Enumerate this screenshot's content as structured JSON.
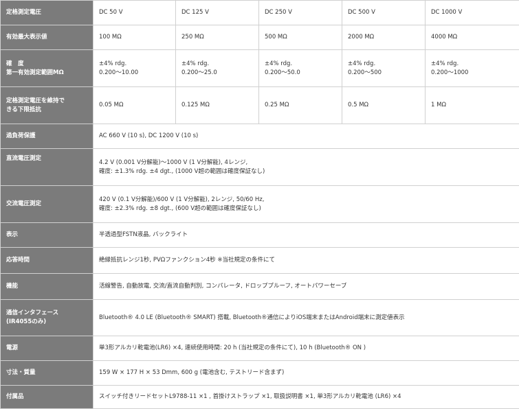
{
  "rows": [
    {
      "label": "定格測定電圧",
      "cells": [
        "DC 50 V",
        "DC 125 V",
        "DC 250 V",
        "DC 500 V",
        "DC 1000 V"
      ]
    },
    {
      "label": "有効最大表示値",
      "cells": [
        "100 MΩ",
        "250 MΩ",
        "500 MΩ",
        "2000 MΩ",
        "4000 MΩ"
      ]
    },
    {
      "label_lines": [
        "確　度",
        "第一有効測定範囲MΩ"
      ],
      "cells": [
        [
          "±4% rdg.",
          "0.200〜10.00"
        ],
        [
          "±4% rdg.",
          "0.200〜25.0"
        ],
        [
          "±4% rdg.",
          "0.200〜50.0"
        ],
        [
          "±4% rdg.",
          "0.200〜500"
        ],
        [
          "±4% rdg.",
          "0.200〜1000"
        ]
      ]
    },
    {
      "label_lines": [
        "定格測定電圧を維持で",
        "きる下限抵抗"
      ],
      "cells": [
        "0.05 MΩ",
        "0.125 MΩ",
        "0.25 MΩ",
        "0.5 MΩ",
        "1 MΩ"
      ]
    },
    {
      "label": "過負荷保護",
      "value": "AC 660 V (10 s), DC 1200 V (10 s)"
    },
    {
      "label": "直流電圧測定",
      "value_lines": [
        "4.2 V (0.001 V分解能)〜1000 V (1 V分解能), 4レンジ,",
        "確度: ±1.3% rdg. ±4 dgt., (1000 V超の範囲は確度保証なし)"
      ]
    },
    {
      "label": "交流電圧測定",
      "value_lines": [
        "420 V (0.1 V分解能)/600 V (1 V分解能), 2レンジ, 50/60 Hz,",
        "確度: ±2.3% rdg. ±8 dgt., (600 V超の範囲は確度保証なし)"
      ]
    },
    {
      "label": "表示",
      "value": "半透過型FSTN液晶, バックライト"
    },
    {
      "label": "応答時間",
      "value": "絶縁抵抗レンジ1秒, PVΩファンクション4秒 ※当社規定の条件にて"
    },
    {
      "label": "機能",
      "value": "活線警告, 自動放電, 交流/直流自動判別, コンパレータ, ドロッププルーフ, オートパワーセーブ"
    },
    {
      "label_lines": [
        "通信インタフェース",
        "(IR4055のみ)"
      ],
      "value": "Bluetooth® 4.0 LE (Bluetooth® SMART) 搭載, Bluetooth®通信によりiOS端末またはAndroid端末に測定値表示"
    },
    {
      "label": "電源",
      "value": "単3形アルカリ乾電池(LR6) ×4, 連続使用時間: 20 h (当社規定の条件にて), 10 h (Bluetooth® ON )"
    },
    {
      "label": "寸法・質量",
      "value": "159 W × 177 H × 53 Dmm, 600 g (電池含む, テストリード含まず)"
    },
    {
      "label": "付属品",
      "value": "スイッチ付きリードセットL9788-11 ×1 , 首掛けストラップ ×1, 取扱説明書 ×1, 単3形アルカリ乾電池 (LR6) ×4"
    }
  ]
}
